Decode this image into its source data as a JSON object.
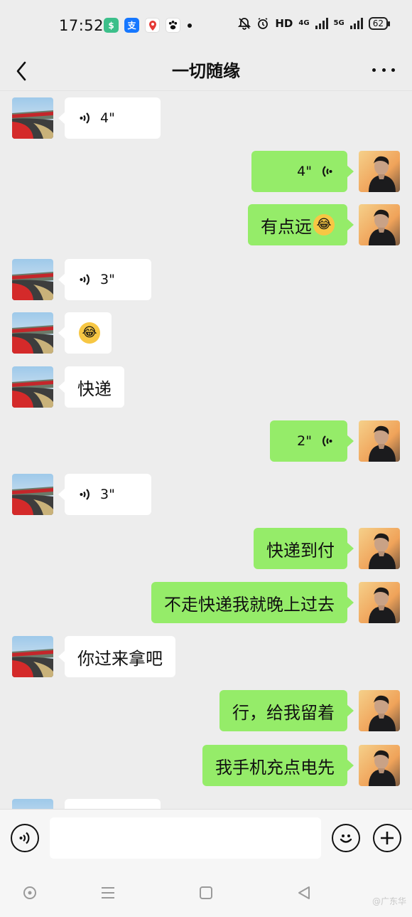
{
  "status_bar": {
    "time": "17:52",
    "hd_label": "HD",
    "network_1": "4G",
    "network_2": "5G",
    "battery": "62"
  },
  "header": {
    "title": "一切随缘"
  },
  "messages": [
    {
      "side": "in",
      "type": "voice",
      "duration": "4\""
    },
    {
      "side": "out",
      "type": "voice",
      "duration": "4\""
    },
    {
      "side": "out",
      "type": "text",
      "text": "有点远",
      "emoji": "face-with-tears-of-joy"
    },
    {
      "side": "in",
      "type": "voice",
      "duration": "3\""
    },
    {
      "side": "in",
      "type": "emoji",
      "emoji": "face-with-tears-of-joy"
    },
    {
      "side": "in",
      "type": "text",
      "text": "快递"
    },
    {
      "side": "out",
      "type": "voice",
      "duration": "2\""
    },
    {
      "side": "in",
      "type": "voice",
      "duration": "3\""
    },
    {
      "side": "out",
      "type": "text",
      "text": "快递到付"
    },
    {
      "side": "out",
      "type": "text",
      "text": "不走快递我就晚上过去"
    },
    {
      "side": "in",
      "type": "text",
      "text": "你过来拿吧"
    },
    {
      "side": "out",
      "type": "text",
      "text": "行，给我留着"
    },
    {
      "side": "out",
      "type": "text",
      "text": "我手机充点电先"
    }
  ],
  "input_bar": {
    "placeholder": ""
  },
  "watermark": "@广东华",
  "colors": {
    "outgoing_bubble": "#95ec69",
    "incoming_bubble": "#ffffff",
    "background": "#ededed"
  }
}
